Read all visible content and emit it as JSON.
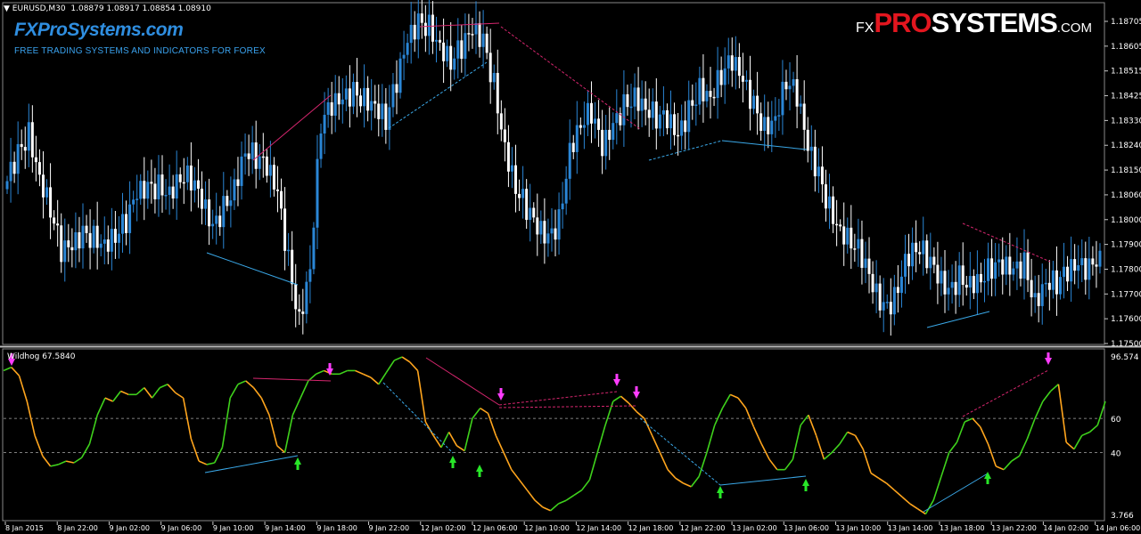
{
  "header": {
    "triangle": "▼",
    "symbol": "EURUSD,M30",
    "ohlc": "1.08879 1.08917 1.08854 1.08910"
  },
  "branding": {
    "title": "FXProSystems.com",
    "subtitle": "FREE TRADING SYSTEMS AND INDICATORS FOR FOREX",
    "logo_fx": "FX",
    "logo_pro": "PRO",
    "logo_systems": "SYSTEMS",
    "logo_com": ".COM"
  },
  "indicator": {
    "label": "Wildhog 67.5840"
  },
  "colors": {
    "background": "#000000",
    "bull_candle": "#2a86d6",
    "bear_candle": "#ffffff",
    "green": "#3fd21c",
    "orange": "#ffa51d",
    "blue_div": "#3aa8e8",
    "pink_div": "#d6266e",
    "magenta_arrow": "#ff3cff",
    "green_arrow": "#28e628",
    "axis": "#c8c8c8"
  },
  "chart_data": [
    {
      "type": "candlestick",
      "title": "EURUSD,M30",
      "ylim": [
        1.175,
        1.1875
      ],
      "y_ticks": [
        "1.18705",
        "1.18605",
        "1.18515",
        "1.18425",
        "1.18330",
        "1.18240",
        "1.18150",
        "1.18060",
        "1.18000",
        "1.17900",
        "1.17800",
        "1.17700",
        "1.17600",
        "1.17500"
      ],
      "x_ticks": [
        "8 Jan 2015",
        "8 Jan 22:00",
        "9 Jan 02:00",
        "9 Jan 06:00",
        "9 Jan 10:00",
        "9 Jan 14:00",
        "9 Jan 18:00",
        "9 Jan 22:00",
        "12 Jan 02:00",
        "12 Jan 06:00",
        "12 Jan 10:00",
        "12 Jan 14:00",
        "12 Jan 18:00",
        "12 Jan 22:00",
        "13 Jan 02:00",
        "13 Jan 06:00",
        "13 Jan 10:00",
        "13 Jan 14:00",
        "13 Jan 18:00",
        "13 Jan 22:00",
        "14 Jan 02:00",
        "14 Jan 06:00"
      ],
      "close_path": [
        1.181,
        1.182,
        1.1828,
        1.1812,
        1.18,
        1.1784,
        1.1785,
        1.179,
        1.1789,
        1.1787,
        1.179,
        1.1795,
        1.1805,
        1.1807,
        1.1808,
        1.1806,
        1.1812,
        1.1811,
        1.1802,
        1.1792,
        1.18,
        1.1808,
        1.1822,
        1.1819,
        1.1815,
        1.1805,
        1.178,
        1.1758,
        1.1778,
        1.1832,
        1.1838,
        1.184,
        1.1843,
        1.1841,
        1.1839,
        1.1833,
        1.1847,
        1.1862,
        1.1869,
        1.1868,
        1.1861,
        1.1855,
        1.186,
        1.1866,
        1.1862,
        1.1846,
        1.1823,
        1.1808,
        1.18,
        1.1792,
        1.1788,
        1.1795,
        1.1822,
        1.1832,
        1.1836,
        1.1822,
        1.183,
        1.1838,
        1.1842,
        1.1838,
        1.1834,
        1.1833,
        1.1826,
        1.1836,
        1.1845,
        1.1842,
        1.185,
        1.1855,
        1.1847,
        1.1838,
        1.183,
        1.1834,
        1.1848,
        1.1842,
        1.1822,
        1.1812,
        1.18,
        1.1792,
        1.1788,
        1.1782,
        1.177,
        1.1762,
        1.1766,
        1.1781,
        1.1786,
        1.1782,
        1.1774,
        1.1768,
        1.1774,
        1.1772,
        1.1774,
        1.1778,
        1.1778,
        1.1776,
        1.1779,
        1.1765,
        1.1773,
        1.1772,
        1.1776,
        1.1778,
        1.1777,
        1.1784
      ],
      "series": [
        {
          "name": "",
          "kind": "blue_divergence",
          "points": [
            [
              "9 Jan 10:00",
              1.1781
            ],
            [
              "9 Jan 14:00",
              1.1772
            ]
          ]
        },
        {
          "name": "",
          "kind": "pink_divergence",
          "points": [
            [
              "9 Jan 14:00",
              1.1818
            ],
            [
              "9 Jan 18:00",
              1.1843
            ]
          ]
        }
      ]
    },
    {
      "type": "line",
      "title": "Wildhog 67.5840",
      "ylim": [
        3.766,
        96.574
      ],
      "y_ticks": [
        "96.574",
        "60",
        "40",
        "3.766"
      ],
      "levels": [
        60,
        40
      ],
      "values": [
        88,
        90,
        85,
        70,
        50,
        38,
        32,
        33,
        35,
        34,
        37,
        45,
        62,
        72,
        70,
        76,
        74,
        74,
        78,
        72,
        78,
        80,
        75,
        72,
        48,
        35,
        33,
        34,
        43,
        72,
        80,
        82,
        78,
        72,
        62,
        44,
        40,
        62,
        72,
        82,
        86,
        88,
        86,
        86,
        88,
        88,
        86,
        84,
        80,
        87,
        94,
        96,
        93,
        88,
        58,
        50,
        43,
        52,
        44,
        41,
        60,
        66,
        63,
        50,
        40,
        30,
        24,
        18,
        12,
        8,
        6,
        10,
        12,
        15,
        18,
        24,
        40,
        56,
        70,
        73,
        69,
        64,
        60,
        50,
        40,
        30,
        25,
        22,
        20,
        26,
        40,
        56,
        66,
        74,
        72,
        66,
        55,
        45,
        36,
        30,
        30,
        36,
        56,
        62,
        50,
        36,
        40,
        45,
        52,
        50,
        42,
        28,
        25,
        22,
        18,
        14,
        10,
        7,
        4,
        12,
        26,
        40,
        46,
        58,
        60,
        55,
        45,
        32,
        30,
        35,
        38,
        48,
        60,
        70,
        76,
        80,
        46,
        42,
        50,
        52,
        56,
        70
      ]
    }
  ]
}
